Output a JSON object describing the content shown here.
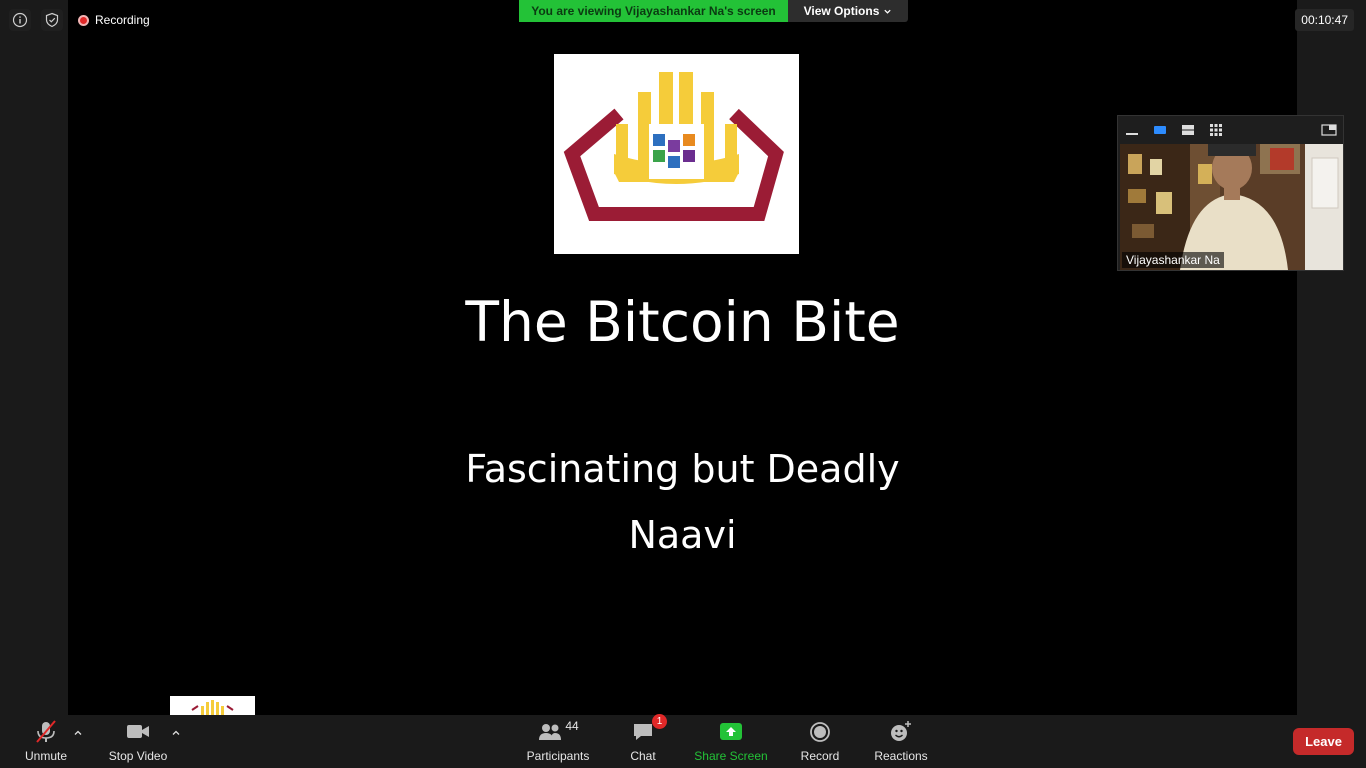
{
  "header": {
    "recording_label": "Recording",
    "viewing_banner": "You are viewing Vijayashankar Na's screen",
    "view_options_label": "View Options",
    "timer": "00:10:47"
  },
  "slide": {
    "title": "The Bitcoin Bite",
    "subtitle": "Fascinating but Deadly",
    "author": "Naavi"
  },
  "video": {
    "participant_name": "Vijayashankar Na"
  },
  "toolbar": {
    "unmute_label": "Unmute",
    "stop_video_label": "Stop Video",
    "participants_label": "Participants",
    "participants_count": "44",
    "chat_label": "Chat",
    "chat_badge": "1",
    "share_screen_label": "Share Screen",
    "record_label": "Record",
    "reactions_label": "Reactions",
    "leave_label": "Leave"
  },
  "colors": {
    "share_green": "#23c237",
    "leave_red": "#c52a2a",
    "record_dot": "#e02828"
  }
}
